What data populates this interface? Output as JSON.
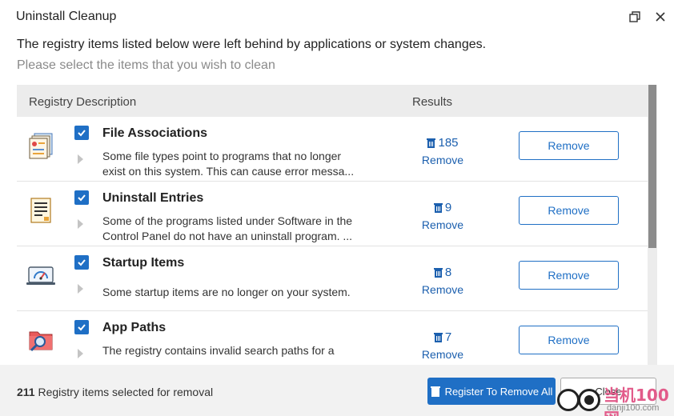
{
  "window": {
    "title": "Uninstall Cleanup"
  },
  "intro": {
    "line1": "The registry items listed below were left behind by applications or system changes.",
    "line2": "Please select the items that you wish to clean"
  },
  "table": {
    "col_description": "Registry Description",
    "col_results": "Results",
    "rows": [
      {
        "icon": "file-associations-icon",
        "checked": true,
        "title": "File Associations",
        "description": "Some file types point to programs that no longer exist on this system. This can cause error messa...",
        "count": "185",
        "count_link": "Remove",
        "button": "Remove"
      },
      {
        "icon": "uninstall-entries-icon",
        "checked": true,
        "title": "Uninstall Entries",
        "description": "Some of the programs listed under Software in the Control Panel do not have an uninstall program. ...",
        "count": "9",
        "count_link": "Remove",
        "button": "Remove"
      },
      {
        "icon": "startup-items-icon",
        "checked": true,
        "title": "Startup Items",
        "description": "Some startup items are no longer on your system.",
        "count": "8",
        "count_link": "Remove",
        "button": "Remove"
      },
      {
        "icon": "app-paths-icon",
        "checked": true,
        "title": "App Paths",
        "description": "The registry contains invalid search paths for a",
        "count": "7",
        "count_link": "Remove",
        "button": "Remove"
      }
    ]
  },
  "footer": {
    "count": "211",
    "status": "Registry items selected for removal",
    "primary_button": "Register To Remove All",
    "close_button": "Close"
  },
  "watermark": {
    "text": "当机100网",
    "sub": "danji100.com"
  },
  "colors": {
    "accent": "#1f6fc5",
    "link": "#1b5fae",
    "header_bg": "#ececec",
    "footer_bg": "#f2f2f2"
  }
}
